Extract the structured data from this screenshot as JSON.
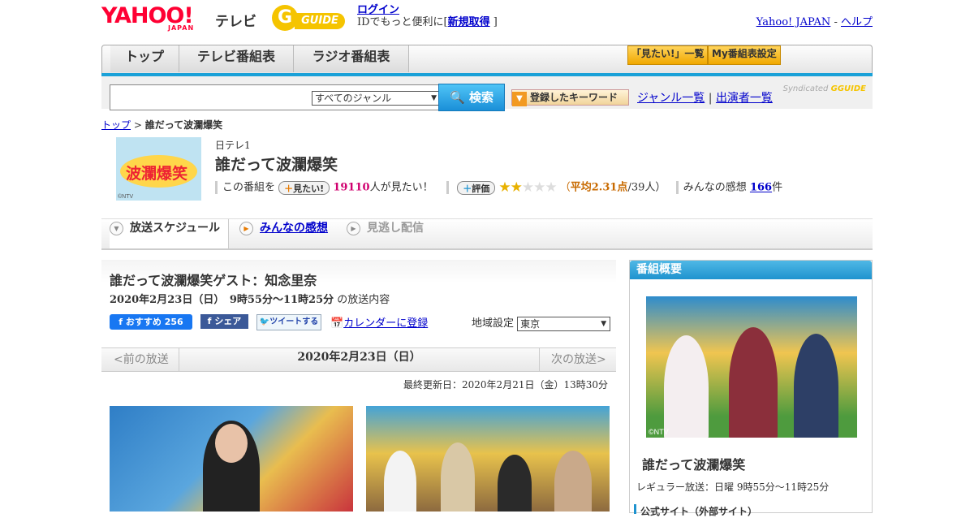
{
  "header": {
    "logo": "YAHOO!",
    "logo_sub": "JAPAN",
    "logo_tv": "テレビ",
    "gguide": "GUIDE",
    "login_link": "ログイン",
    "login_text": "IDでもっと便利に[",
    "register_link": "新規取得",
    "login_text_end": "]",
    "yj_link": "Yahoo! JAPAN",
    "sep": "-",
    "help_link": "ヘルプ"
  },
  "nav": {
    "tabs": [
      "トップ",
      "テレビ番組表",
      "ラジオ番組表"
    ],
    "mitai_list": "「見たい!」一覧",
    "my_schedule": "My番組表設定"
  },
  "search": {
    "placeholder": "",
    "genre": "すべてのジャンル",
    "button": "検索",
    "keyword_button": "登録したキーワード",
    "genre_list": "ジャンル一覧",
    "divider": "|",
    "performer_list": "出演者一覧",
    "syndicated": "Syndicated"
  },
  "breadcrumb": {
    "top": "トップ",
    "sep": ">",
    "current": "誰だって波瀾爆笑"
  },
  "program": {
    "thumb_text": "波瀾爆笑",
    "copyright": "©NTV",
    "channel": "日テレ1",
    "title": "誰だって波瀾爆笑",
    "this_program": "この番組を",
    "mitai_button": "見たい!",
    "mitai_count": "19110",
    "mitai_suffix": "人が見たい！",
    "rating_button": "評価",
    "rating": 2.31,
    "rating_open": "（",
    "rating_avg": "平均2.31点",
    "rating_rest": "/39人）",
    "reviews_label": "みんなの感想",
    "reviews_count": "166",
    "reviews_suffix": "件"
  },
  "content_tabs": [
    "放送スケジュール",
    "みんなの感想",
    "見逃し配信"
  ],
  "episode": {
    "title": "誰だって波瀾爆笑ゲスト：知念里奈",
    "date": "2020年2月23日（日）　9時55分～11時25分",
    "date_suffix": "の放送内容",
    "fb_recommend": "おすすめ",
    "fb_count": "256",
    "fb_share": "シェア",
    "tweet": "ツイートする",
    "calendar": "カレンダーに登録",
    "region_label": "地域設定",
    "region": "東京"
  },
  "pager": {
    "prev": "<前の放送",
    "current": "2020年2月23日（日）",
    "next": "次の放送>"
  },
  "updated": "最終更新日：2020年2月21日（金）13時30分",
  "side": {
    "heading": "番組概要",
    "copyright": "©NTV",
    "title": "誰だって波瀾爆笑",
    "regular": "レギュラー放送：日曜 9時55分～11時25分",
    "official": "公式サイト（外部サイト）"
  },
  "colors": {
    "accent_blue": "#1aa1d8",
    "yahoo_red": "#ff0033",
    "guide_yellow": "#f5c400",
    "pink_count": "#d0006f"
  }
}
